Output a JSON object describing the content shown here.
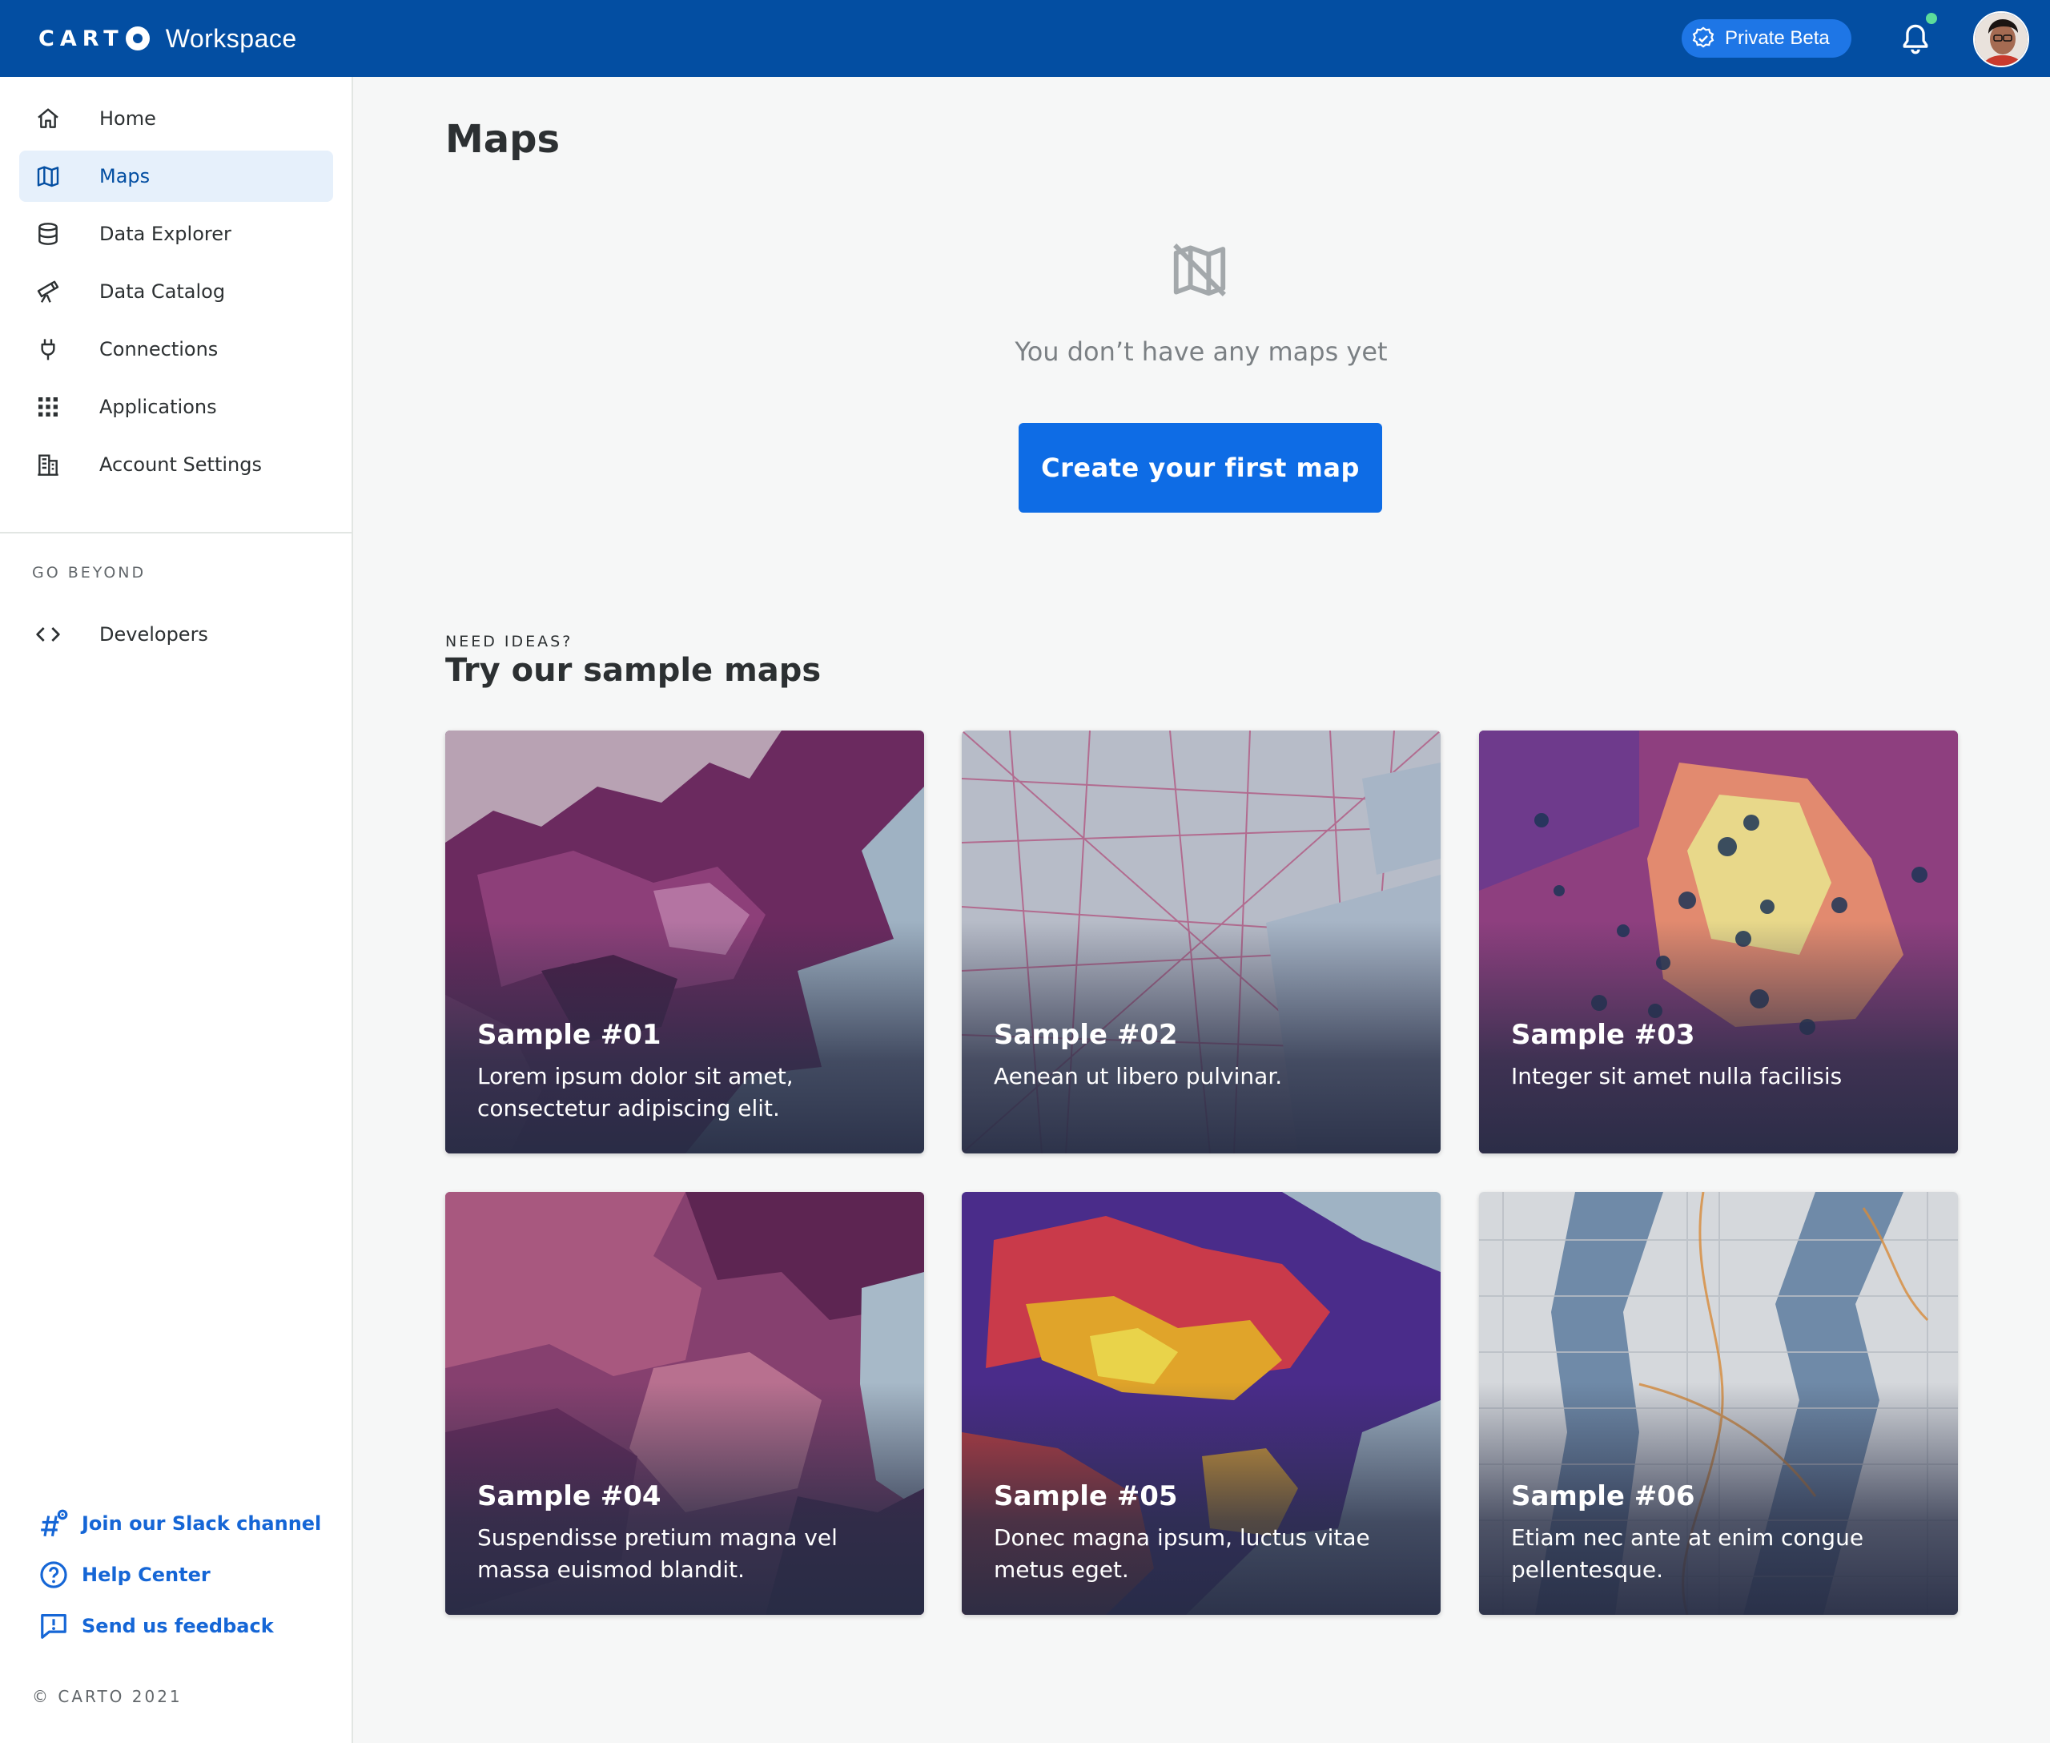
{
  "header": {
    "logo_text": "CART",
    "app_name": "Workspace",
    "beta_label": "Private Beta",
    "brand_color": "#034ea2"
  },
  "sidebar": {
    "items": [
      {
        "label": "Home",
        "icon": "home-icon"
      },
      {
        "label": "Maps",
        "icon": "map-icon",
        "active": true
      },
      {
        "label": "Data Explorer",
        "icon": "database-icon"
      },
      {
        "label": "Data Catalog",
        "icon": "telescope-icon"
      },
      {
        "label": "Connections",
        "icon": "plug-icon"
      },
      {
        "label": "Applications",
        "icon": "grid-icon"
      },
      {
        "label": "Account Settings",
        "icon": "building-icon"
      }
    ],
    "section_label": "GO BEYOND",
    "beyond_items": [
      {
        "label": "Developers",
        "icon": "code-icon"
      }
    ],
    "help_links": [
      {
        "label": "Join our Slack channel",
        "icon": "slack-icon"
      },
      {
        "label": "Help Center",
        "icon": "help-circle-icon"
      },
      {
        "label": "Send us feedback",
        "icon": "feedback-icon"
      }
    ],
    "copyright": "© CARTO 2021"
  },
  "main": {
    "title": "Maps",
    "empty_state": {
      "icon": "map-off-icon",
      "message": "You don’t have any maps yet",
      "button_label": "Create your first map"
    },
    "samples": {
      "eyebrow": "NEED IDEAS?",
      "title": "Try our sample maps",
      "cards": [
        {
          "title": "Sample #01",
          "description": "Lorem ipsum dolor sit amet, consectetur adipiscing elit."
        },
        {
          "title": "Sample #02",
          "description": "Aenean ut libero pulvinar."
        },
        {
          "title": "Sample #03",
          "description": "Integer sit amet nulla facilisis"
        },
        {
          "title": "Sample #04",
          "description": "Suspendisse pretium magna vel massa euismod blandit."
        },
        {
          "title": "Sample #05",
          "description": "Donec magna ipsum, luctus vitae metus eget."
        },
        {
          "title": "Sample #06",
          "description": "Etiam nec ante at enim congue pellentesque."
        }
      ]
    },
    "accent_color": "#0e6ce5"
  }
}
